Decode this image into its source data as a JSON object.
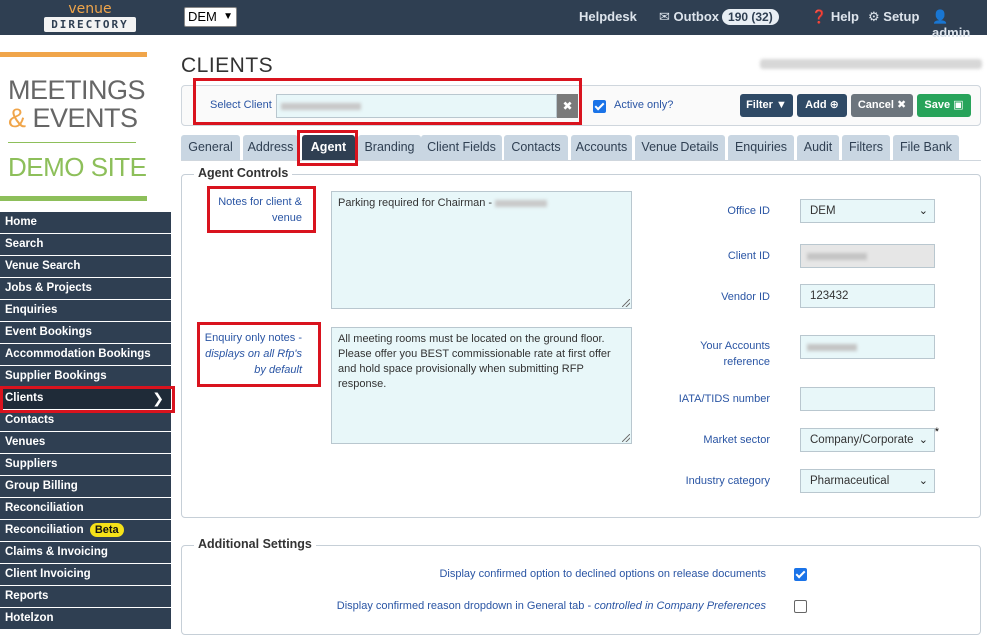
{
  "topbar": {
    "logo_line1": "venue",
    "logo_line2": "DIRECTORY",
    "org_selected": "DEM",
    "helpdesk": "Helpdesk",
    "outbox_label": "Outbox",
    "outbox_count": "190 (32)",
    "help": "Help",
    "setup": "Setup",
    "user": "admin"
  },
  "brand": {
    "line1": "MEETINGS",
    "amp": "&",
    "line2": "EVENTS",
    "line3": "DEMO SITE"
  },
  "menu": {
    "items": [
      {
        "label": "Home"
      },
      {
        "label": "Search"
      },
      {
        "label": "Venue Search"
      },
      {
        "label": "Jobs & Projects"
      },
      {
        "label": "Enquiries"
      },
      {
        "label": "Event Bookings"
      },
      {
        "label": "Accommodation Bookings"
      },
      {
        "label": "Supplier Bookings"
      },
      {
        "label": "Clients"
      },
      {
        "label": "Contacts"
      },
      {
        "label": "Venues"
      },
      {
        "label": "Suppliers"
      },
      {
        "label": "Group Billing"
      },
      {
        "label": "Reconciliation"
      },
      {
        "label": "Reconciliation",
        "badge": "Beta"
      },
      {
        "label": "Claims & Invoicing"
      },
      {
        "label": "Client Invoicing"
      },
      {
        "label": "Reports"
      },
      {
        "label": "Hotelzon"
      }
    ]
  },
  "page": {
    "title": "CLIENTS",
    "select_client_label": "Select Client",
    "active_only_label": "Active only?",
    "buttons": {
      "filter": "Filter",
      "add": "Add",
      "cancel": "Cancel",
      "save": "Save"
    }
  },
  "tabs": [
    "General",
    "Address",
    "Agent",
    "Branding",
    "Client Fields",
    "Contacts",
    "Accounts",
    "Venue Details",
    "Enquiries",
    "Audit",
    "Filters",
    "File Bank"
  ],
  "agent_controls": {
    "legend": "Agent Controls",
    "notes_label_1": "Notes for client &",
    "notes_label_2": "venue",
    "notes_value": "Parking required for Chairman -",
    "enquiry_label_1": "Enquiry only notes -",
    "enquiry_label_2": "displays on all Rfp's",
    "enquiry_label_3": "by default",
    "enquiry_value": "All meeting rooms must be located on the ground floor. Please offer you BEST commissionable rate at first offer and hold space provisionally when submitting RFP response.",
    "office_id_label": "Office ID",
    "office_id_value": "DEM",
    "client_id_label": "Client ID",
    "vendor_id_label": "Vendor ID",
    "vendor_id_value": "123432",
    "accounts_ref_label_1": "Your Accounts",
    "accounts_ref_label_2": "reference",
    "iata_label": "IATA/TIDS number",
    "iata_value": "",
    "market_sector_label": "Market sector",
    "market_sector_value": "Company/Corporate",
    "required_mark": "*",
    "industry_label": "Industry category",
    "industry_value": "Pharmaceutical"
  },
  "additional": {
    "legend": "Additional Settings",
    "setting1_label": "Display confirmed option to declined options on release documents",
    "setting1_checked": true,
    "setting2_label": "Display confirmed reason dropdown in General tab -",
    "setting2_note": "controlled in Company Preferences",
    "setting2_checked": false
  },
  "colors": {
    "nav_bg": "#2f3f52",
    "accent_orange": "#f0a54a",
    "accent_green": "#8dbf5a",
    "highlight_red": "#d9131e",
    "save_green": "#27a35a",
    "tab_inactive": "#c9d6e2"
  }
}
